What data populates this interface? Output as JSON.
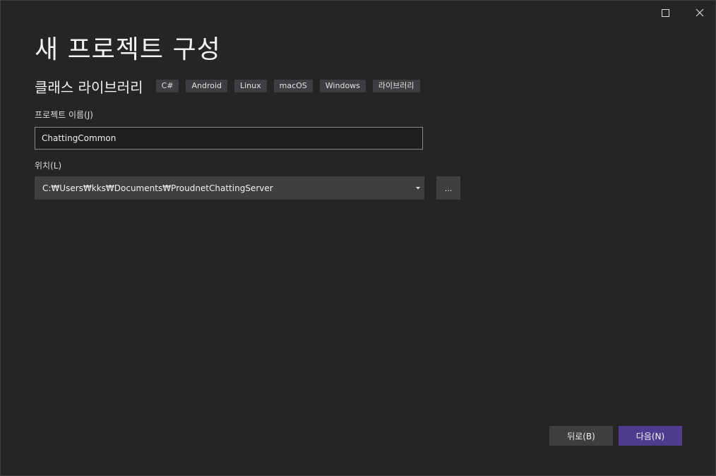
{
  "window": {
    "maximize_icon": "maximize-icon",
    "close_icon": "close-icon"
  },
  "page": {
    "title": "새 프로젝트 구성"
  },
  "template": {
    "name": "클래스 라이브러리",
    "tags": [
      "C#",
      "Android",
      "Linux",
      "macOS",
      "Windows",
      "라이브러리"
    ]
  },
  "project_name": {
    "label": "프로젝트 이름(J)",
    "value": "ChattingCommon"
  },
  "location": {
    "label": "위치(L)",
    "value": "C:₩Users₩kks₩Documents₩ProudnetChattingServer",
    "browse_label": "..."
  },
  "footer": {
    "back_label": "뒤로(B)",
    "next_label": "다음(N)"
  },
  "colors": {
    "background": "#252526",
    "control": "#3f3f42",
    "primary_button": "#4f3b8f"
  }
}
